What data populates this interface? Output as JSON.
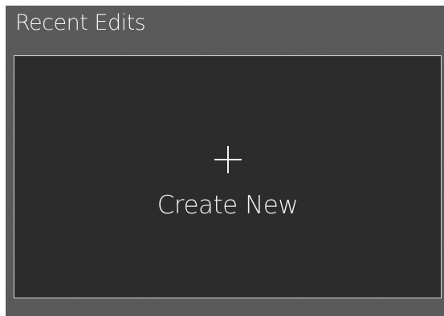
{
  "panel": {
    "title": "Recent Edits"
  },
  "create_card": {
    "icon": "plus-icon",
    "label": "Create New"
  },
  "colors": {
    "panel_background": "#595959",
    "card_background": "#2c2c2c",
    "card_border": "#d8d8d8",
    "text": "#f2f2f2"
  }
}
